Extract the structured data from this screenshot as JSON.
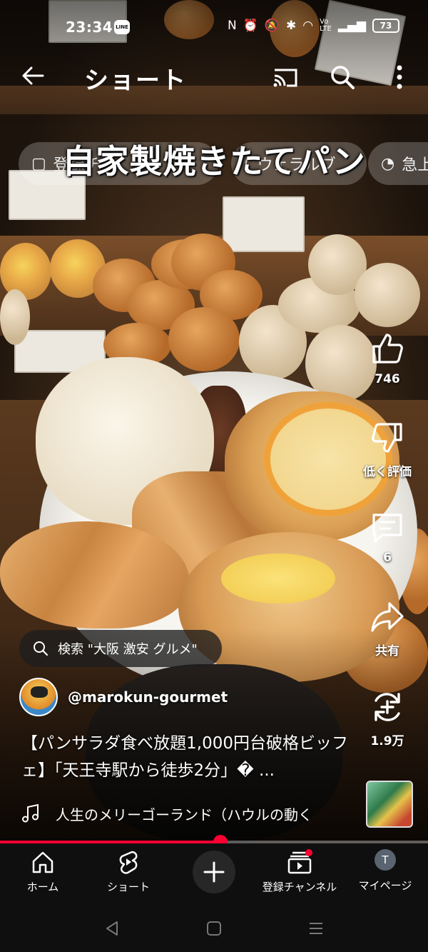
{
  "status_bar": {
    "time": "23:34",
    "line_badge": "LINE",
    "battery": "73"
  },
  "app_bar": {
    "title": "ショート"
  },
  "overlay": {
    "caption": "自家製焼きたてパン"
  },
  "chips": [
    {
      "label": "登録チャ",
      "icon": "calendar-icon"
    },
    {
      "label": "ウェラルブ",
      "icon": "chevron-icon"
    },
    {
      "label": "急上",
      "icon": "flame-icon"
    }
  ],
  "actions": {
    "like_count": "746",
    "dislike_label": "低く評価",
    "comment_count": "6",
    "share_label": "共有",
    "remix_count": "1.9万"
  },
  "search_suggestion": {
    "text": "検索 \"大阪 激安 グルメ\""
  },
  "channel": {
    "handle": "@marokun-gourmet"
  },
  "video": {
    "title": "【パンサラダ食べ放題1,000円台破格ビッフェ】「天王寺駅から徒歩2分」� ...",
    "progress": 0.515
  },
  "music": {
    "track": "人生のメリーゴーランド（ハウルの動く"
  },
  "bottom_nav": {
    "home": "ホーム",
    "shorts": "ショート",
    "subscriptions": "登録チャンネル",
    "you": "マイページ",
    "you_initial": "T"
  },
  "colors": {
    "accent": "#ff0033",
    "nav_bg": "#0f0f0f"
  }
}
